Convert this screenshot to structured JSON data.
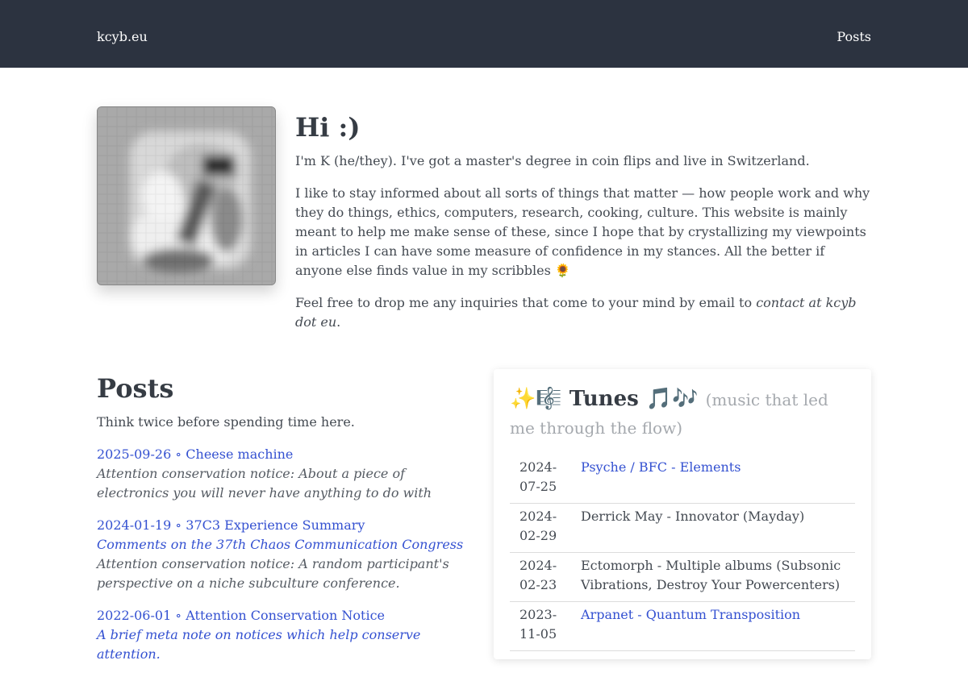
{
  "nav": {
    "brand": "kcyb.eu",
    "posts_link": "Posts"
  },
  "intro": {
    "heading": "Hi :)",
    "p1": "I'm K (he/they). I've got a master's degree in coin flips and live in Switzerland.",
    "p2": "I like to stay informed about all sorts of things that matter — how people work and why they do things, ethics, computers, research, cooking, culture. This website is mainly meant to help me make sense of these, since I hope that by crystallizing my viewpoints in articles I can have some measure of confidence in my stances. All the better if anyone else finds value in my scribbles 🌻",
    "p3_prefix": "Feel free to drop me any inquiries that come to your mind by email to ",
    "p3_email": "contact at kcyb dot eu",
    "p3_suffix": "."
  },
  "posts": {
    "heading": "Posts",
    "lead": "Think twice before spending time here.",
    "items": [
      {
        "link": "2025-09-26 ∘ Cheese machine",
        "subtitle": "",
        "notice": "Attention conservation notice: About a piece of electronics you will never have anything to do with"
      },
      {
        "link": "2024-01-19 ∘ 37C3 Experience Summary",
        "subtitle": "Comments on the 37th Chaos Communication Congress",
        "notice": "Attention conservation notice: A random participant's perspective on a niche subculture conference."
      },
      {
        "link": "2022-06-01 ∘ Attention Conservation Notice",
        "subtitle": "A brief meta note on notices which help conserve attention.",
        "notice": ""
      }
    ]
  },
  "tunes": {
    "title": "✨🎼 Tunes 🎵🎶",
    "subtitle": "(music that led me through the flow)",
    "rows": [
      {
        "date": "2024-07-25",
        "title": "Psyche / BFC - Elements",
        "linked": true
      },
      {
        "date": "2024-02-29",
        "title": "Derrick May - Innovator (Mayday)",
        "linked": false
      },
      {
        "date": "2024-02-23",
        "title": "Ectomorph - Multiple albums (Subsonic Vibrations, Destroy Your Powercenters)",
        "linked": false
      },
      {
        "date": "2023-11-05",
        "title": "Arpanet - Quantum Transposition",
        "linked": true
      }
    ]
  }
}
